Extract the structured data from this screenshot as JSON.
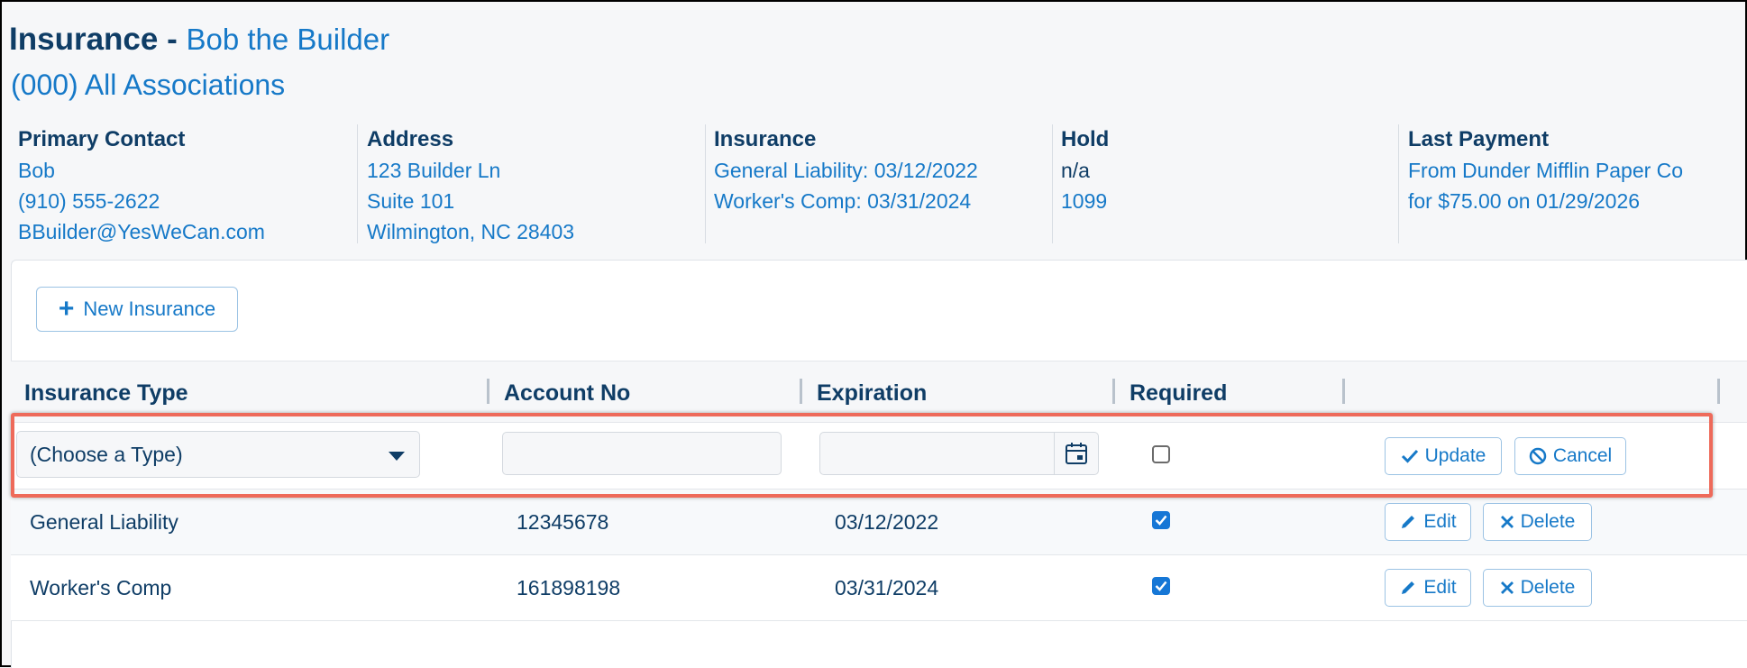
{
  "header": {
    "title": "Insurance -",
    "vendor_name": "Bob the Builder",
    "association": "(000) All Associations"
  },
  "info": {
    "primary_contact": {
      "label": "Primary Contact",
      "name": "Bob",
      "phone": "(910) 555-2622",
      "email": "BBuilder@YesWeCan.com"
    },
    "address": {
      "label": "Address",
      "line1": "123 Builder Ln",
      "line2": "Suite 101",
      "line3": "Wilmington, NC 28403"
    },
    "insurance": {
      "label": "Insurance",
      "line1": "General Liability: 03/12/2022",
      "line2": "Worker's Comp: 03/31/2024"
    },
    "hold": {
      "label": "Hold",
      "line1": "n/a",
      "line2": "1099"
    },
    "last_payment": {
      "label": "Last Payment",
      "line1": "From Dunder Mifflin Paper Co",
      "line2": "for $75.00 on 01/29/2026"
    }
  },
  "toolbar": {
    "new_label": "New Insurance"
  },
  "table": {
    "columns": [
      "Insurance Type",
      "Account No",
      "Expiration",
      "Required"
    ],
    "edit_row": {
      "type_placeholder": "(Choose a Type)",
      "account_value": "",
      "expiration_value": "",
      "required": false,
      "update_label": "Update",
      "cancel_label": "Cancel"
    },
    "rows": [
      {
        "type": "General Liability",
        "account": "12345678",
        "expiration": "03/12/2022",
        "required": true
      },
      {
        "type": "Worker's Comp",
        "account": "161898198",
        "expiration": "03/31/2024",
        "required": true
      }
    ],
    "edit_label": "Edit",
    "delete_label": "Delete"
  },
  "colors": {
    "accent": "#1679c8",
    "text": "#0f3d66",
    "highlight": "#ee6a5a",
    "checkbox": "#1677d6"
  }
}
